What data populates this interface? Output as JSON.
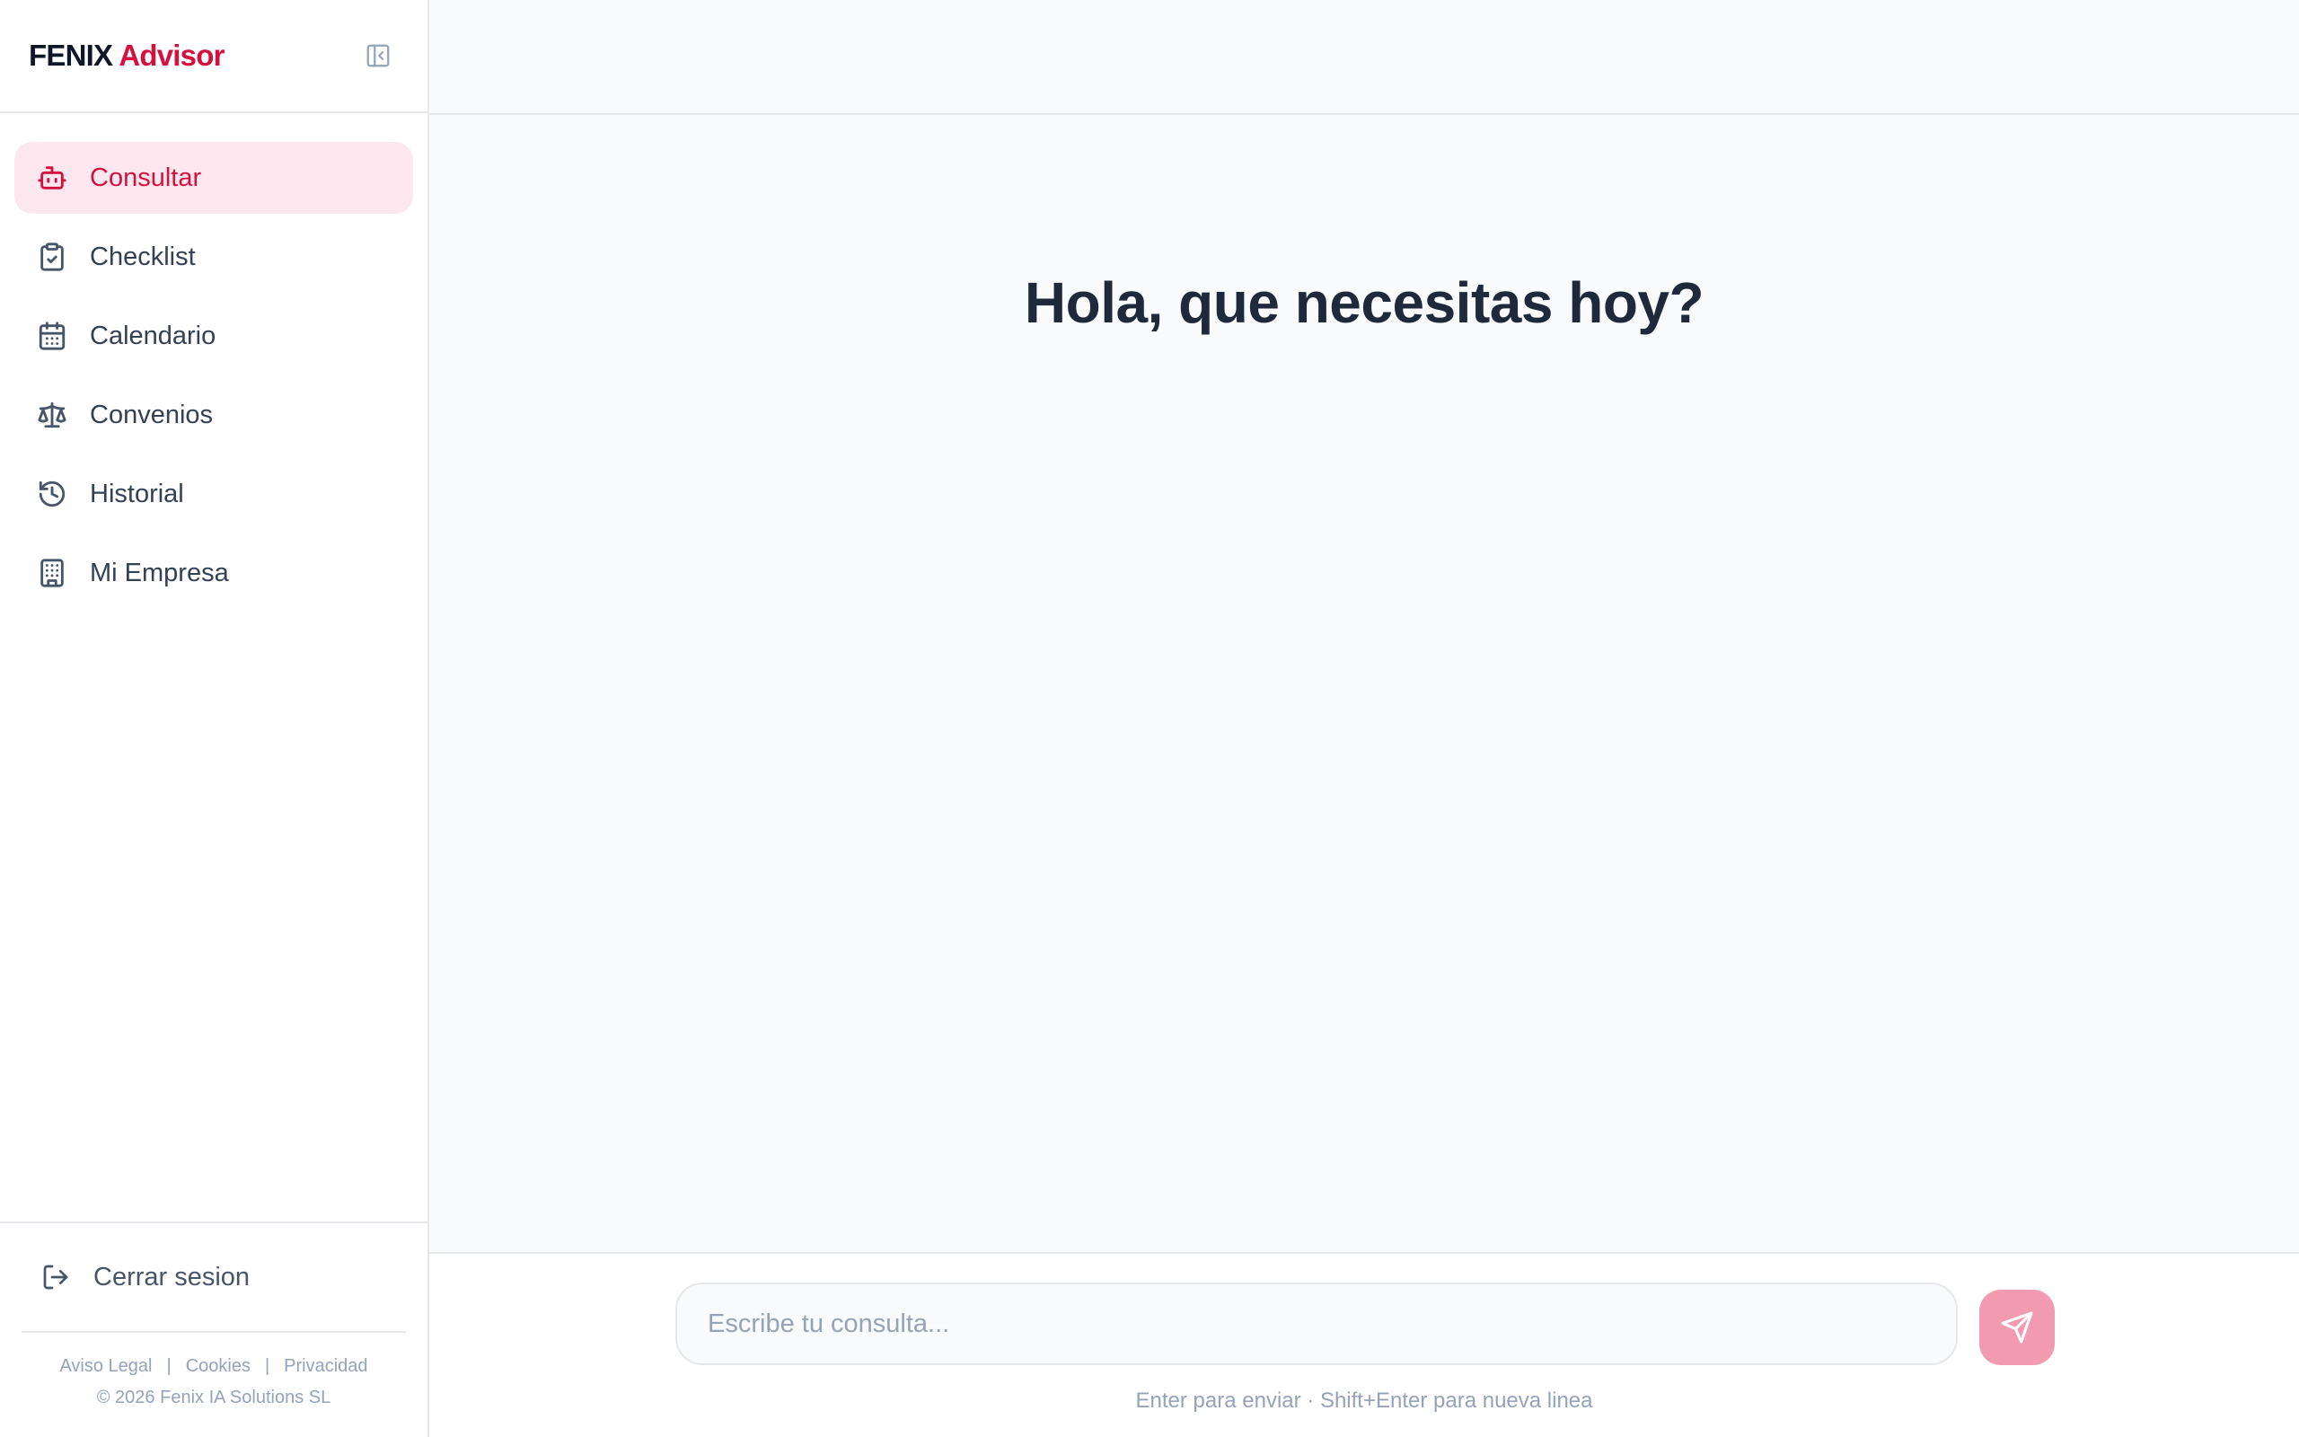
{
  "brand": {
    "part1": "FENIX",
    "part2": "Advisor"
  },
  "sidebar": {
    "items": [
      {
        "label": "Consultar",
        "icon": "bot-icon",
        "active": true
      },
      {
        "label": "Checklist",
        "icon": "clipboard-check-icon"
      },
      {
        "label": "Calendario",
        "icon": "calendar-icon"
      },
      {
        "label": "Convenios",
        "icon": "scale-icon"
      },
      {
        "label": "Historial",
        "icon": "history-icon"
      },
      {
        "label": "Mi Empresa",
        "icon": "building-icon"
      }
    ],
    "logout": "Cerrar sesion",
    "legal": {
      "aviso": "Aviso Legal",
      "cookies": "Cookies",
      "privacidad": "Privacidad",
      "sep": "|"
    },
    "copyright": "© 2026 Fenix IA Solutions SL"
  },
  "main": {
    "greeting": "Hola, que necesitas hoy?"
  },
  "composer": {
    "placeholder": "Escribe tu consulta...",
    "hint": "Enter para enviar · Shift+Enter para nueva linea"
  },
  "colors": {
    "accent": "#d4113e",
    "accent_soft": "#fde7ee",
    "send_button": "#f29ab0"
  }
}
